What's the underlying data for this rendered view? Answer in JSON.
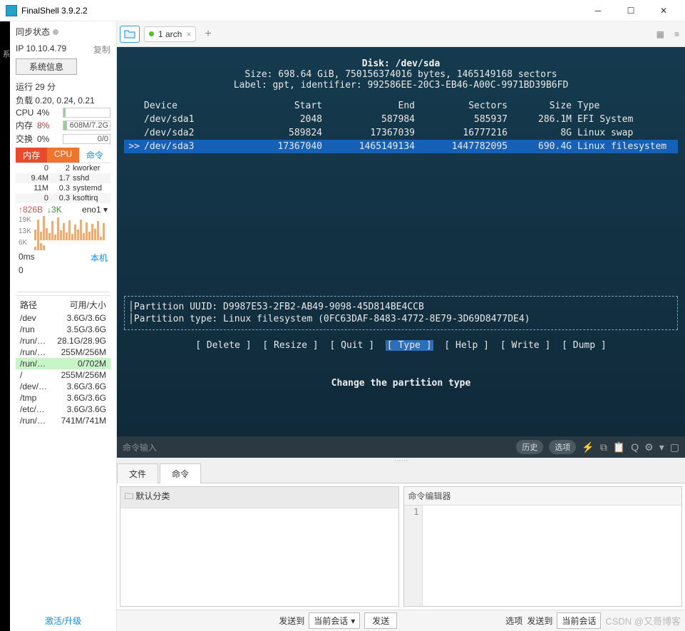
{
  "app": {
    "title": "FinalShell 3.9.2.2"
  },
  "sidebar": {
    "sync_label": "同步状态",
    "ip_label": "IP 10.10.4.79",
    "copy_label": "复制",
    "sysinfo_btn": "系统信息",
    "uptime": "运行 29 分",
    "load": "负载 0.20, 0.24, 0.21",
    "cpu_label": "CPU",
    "cpu_pct": "4%",
    "cpu_text": "",
    "mem_label": "内存",
    "mem_pct": "8%",
    "mem_text": "608M/7.2G",
    "swap_label": "交换",
    "swap_pct": "0%",
    "swap_text": "0/0",
    "tabs": {
      "mem": "内存",
      "cpu": "CPU",
      "cmd": "命令"
    },
    "procs": [
      {
        "m": "0",
        "c": "2",
        "n": "kworker"
      },
      {
        "m": "9.4M",
        "c": "1.7",
        "n": "sshd"
      },
      {
        "m": "11M",
        "c": "0.3",
        "n": "systemd"
      },
      {
        "m": "0",
        "c": "0.3",
        "n": "ksoftirq"
      }
    ],
    "net": {
      "up": "826B",
      "dn": "3K",
      "iface": "eno1"
    },
    "spark_labels": [
      "19K",
      "13K",
      "6K"
    ],
    "ping": {
      "t": "0ms",
      "lbl": "本机",
      "v": "0"
    },
    "path_head": {
      "p": "路径",
      "s": "可用/大小"
    },
    "disks": [
      {
        "p": "/dev",
        "s": "3.6G/3.6G"
      },
      {
        "p": "/run",
        "s": "3.5G/3.6G"
      },
      {
        "p": "/run/…",
        "s": "28.1G/28.9G"
      },
      {
        "p": "/run/…",
        "s": "255M/256M"
      },
      {
        "p": "/run/…",
        "s": "0/702M",
        "hl": true
      },
      {
        "p": "/",
        "s": "255M/256M"
      },
      {
        "p": "/dev/…",
        "s": "3.6G/3.6G"
      },
      {
        "p": "/tmp",
        "s": "3.6G/3.6G"
      },
      {
        "p": "/etc/…",
        "s": "3.6G/3.6G"
      },
      {
        "p": "/run/…",
        "s": "741M/741M"
      }
    ],
    "activate": "激活/升级"
  },
  "tabs": {
    "t1": "1 arch"
  },
  "term": {
    "disk": "Disk: /dev/sda",
    "size": "Size: 698.64 GiB, 750156374016 bytes, 1465149168 sectors",
    "label": "Label: gpt, identifier: 992586EE-20C3-EB46-A00C-9971BD39B6FD",
    "cols": {
      "dev": "Device",
      "start": "Start",
      "end": "End",
      "sec": "Sectors",
      "sz": "Size",
      "tp": "Type"
    },
    "rows": [
      {
        "dev": "/dev/sda1",
        "start": "2048",
        "end": "587984",
        "sec": "585937",
        "sz": "286.1M",
        "tp": "EFI System"
      },
      {
        "dev": "/dev/sda2",
        "start": "589824",
        "end": "17367039",
        "sec": "16777216",
        "sz": "8G",
        "tp": "Linux swap"
      },
      {
        "dev": "/dev/sda3",
        "start": "17367040",
        "end": "1465149134",
        "sec": "1447782095",
        "sz": "690.4G",
        "tp": "Linux filesystem",
        "sel": true,
        "ind": ">>"
      }
    ],
    "uuid": "Partition UUID: D9987E53-2FB2-AB49-9098-45D814BE4CCB",
    "ptype": "Partition type: Linux filesystem (0FC63DAF-8483-4772-8E79-3D69D8477DE4)",
    "menu": [
      "[ Delete ]",
      "[ Resize ]",
      "[  Quit  ]",
      "[  Type  ]",
      "[  Help  ]",
      "[  Write ]",
      "[  Dump  ]"
    ],
    "menu_sel": 3,
    "hint": "Change the partition type"
  },
  "cmdbar": {
    "ph": "命令输入",
    "hist": "历史",
    "opt": "选项"
  },
  "btabs": {
    "file": "文件",
    "cmd": "命令"
  },
  "panes": {
    "cat": "默认分类",
    "editor": "命令编辑器",
    "ln": "1"
  },
  "footer": {
    "send_to": "发送到",
    "cur": "当前会话",
    "send": "发送",
    "opt": "选项",
    "watermark": "CSDN @又哥博客"
  }
}
